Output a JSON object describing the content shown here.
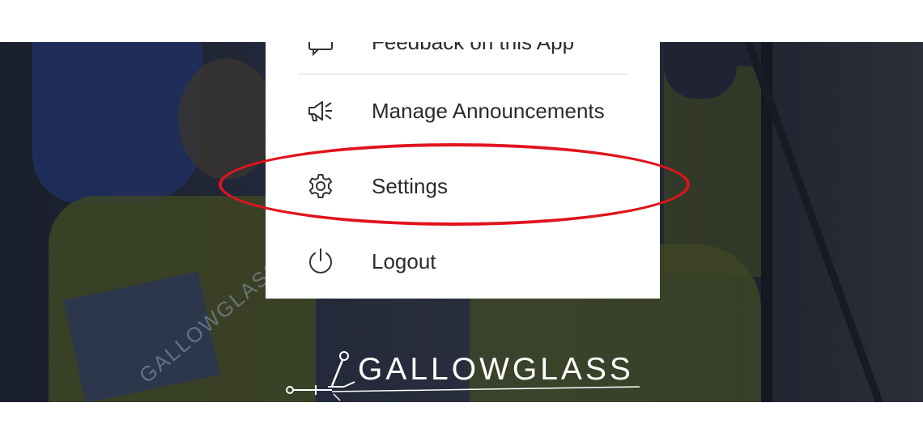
{
  "menu": {
    "items": [
      {
        "label": "Feedback on this App",
        "icon": "feedback-icon"
      },
      {
        "label": "Manage Announcements",
        "icon": "megaphone-icon"
      },
      {
        "label": "Settings",
        "icon": "gear-icon"
      },
      {
        "label": "Logout",
        "icon": "power-icon"
      }
    ]
  },
  "logo": {
    "text": "GALLOWGLASS"
  },
  "background": {
    "vest_text": "GALLOWGLASS"
  },
  "colors": {
    "highlight": "#e0141e",
    "menu_background": "#ffffff",
    "menu_text": "#2b2b2b"
  }
}
